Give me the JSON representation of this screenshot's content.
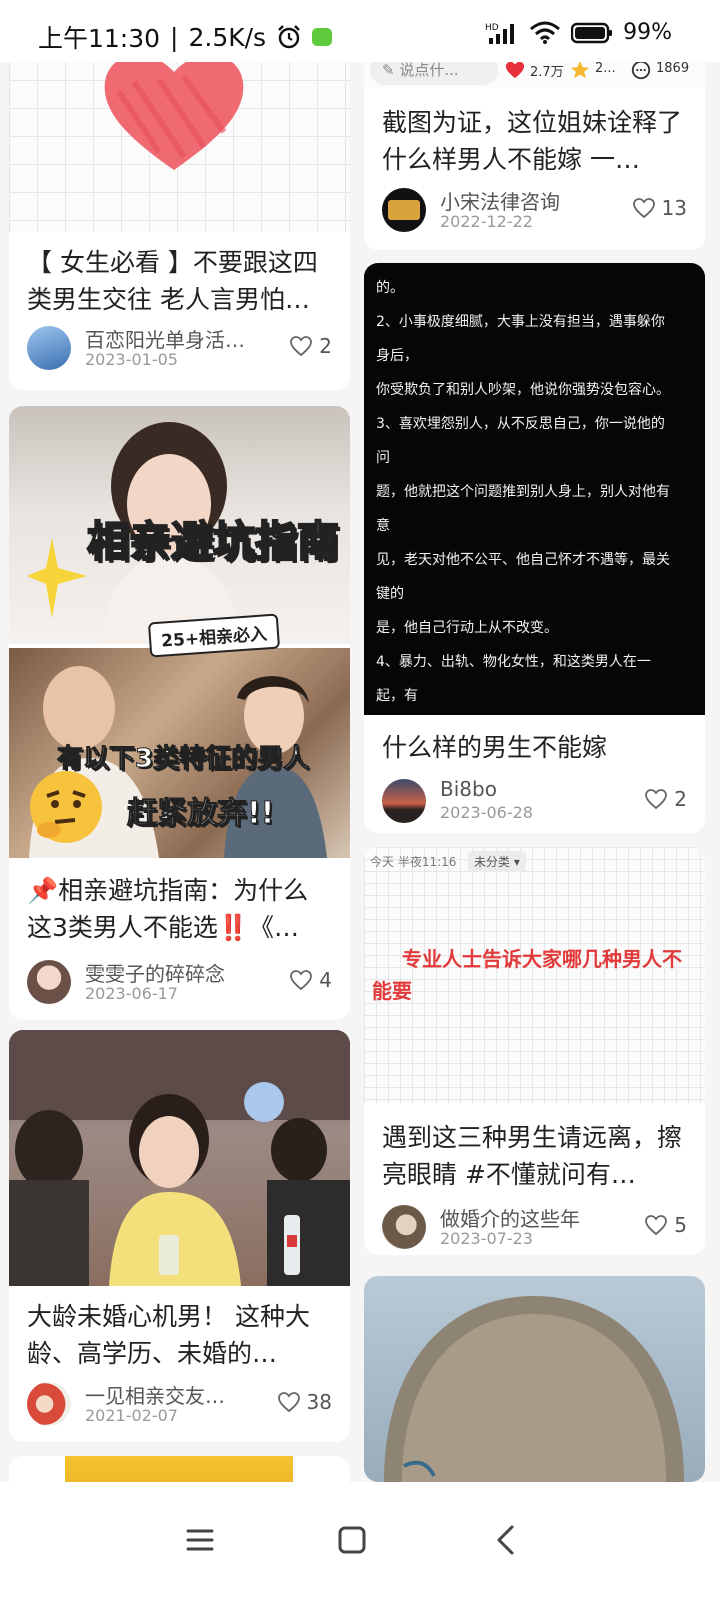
{
  "status": {
    "time": "上午11:30",
    "speed": "2.5K/s",
    "battery": "99%",
    "signal_label": "HD"
  },
  "left_cards": [
    {
      "title": "【 女生必看 】不要跟这四类男生交往 老人言男怕…",
      "author": "百恋阳光单身活…",
      "date": "2023-01-05",
      "likes": "2"
    },
    {
      "image_text": {
        "headline": "相亲避坑指南",
        "tag": "25+相亲必入",
        "line1": "有以下3类特征的男人",
        "line2": "赶紧放弃!!"
      },
      "title": "📌相亲避坑指南：为什么这3类男人不能选‼️《…",
      "author": "雯雯子的碎碎念",
      "date": "2023-06-17",
      "likes": "4"
    },
    {
      "title": "大龄未婚心机男！ 这种大龄、高学历、未婚的…",
      "author": "一见相亲交友…",
      "date": "2021-02-07",
      "likes": "38"
    }
  ],
  "right_cards": [
    {
      "top_bar": {
        "comment_placeholder": "说点什...",
        "likes": "2.7万",
        "stars": "2...",
        "comments": "1869"
      },
      "title": "截图为证，这位姐妹诠释了什么样男人不能嫁 一…",
      "author": "小宋法律咨询",
      "date": "2022-12-22",
      "likes": "13"
    },
    {
      "image_lines": [
        "的。",
        "2、小事极度细腻，大事上没有担当，遇事躲你",
        "身后，",
        "你受欺负了和别人吵架，他说你强势没包容心。",
        "3、喜欢埋怨别人，从不反思自己，你一说他的",
        "问",
        "题，他就把这个问题推到别人身上，别人对他有",
        "意",
        "见，老天对他不公平、他自己怀才不遇等，最关",
        "键的",
        "是，他自己行动上从不改变。",
        "4、暴力、出轨、物化女性，和这类男人在一",
        "起，有"
      ],
      "title": "什么样的男生不能嫁",
      "author": "Bi8bo",
      "date": "2023-06-28",
      "likes": "2"
    },
    {
      "note_header": {
        "time": "今天 半夜11:16",
        "category": "未分类 ▾"
      },
      "note_text": "专业人士告诉大家哪几种男人不能要",
      "title": "遇到这三种男生请远离，擦亮眼睛 #不懂就问有…",
      "author": "做婚介的这些年",
      "date": "2023-07-23",
      "likes": "5"
    }
  ],
  "colors": {
    "accent_red": "#e8303a",
    "note_red": "#e23a3a"
  }
}
